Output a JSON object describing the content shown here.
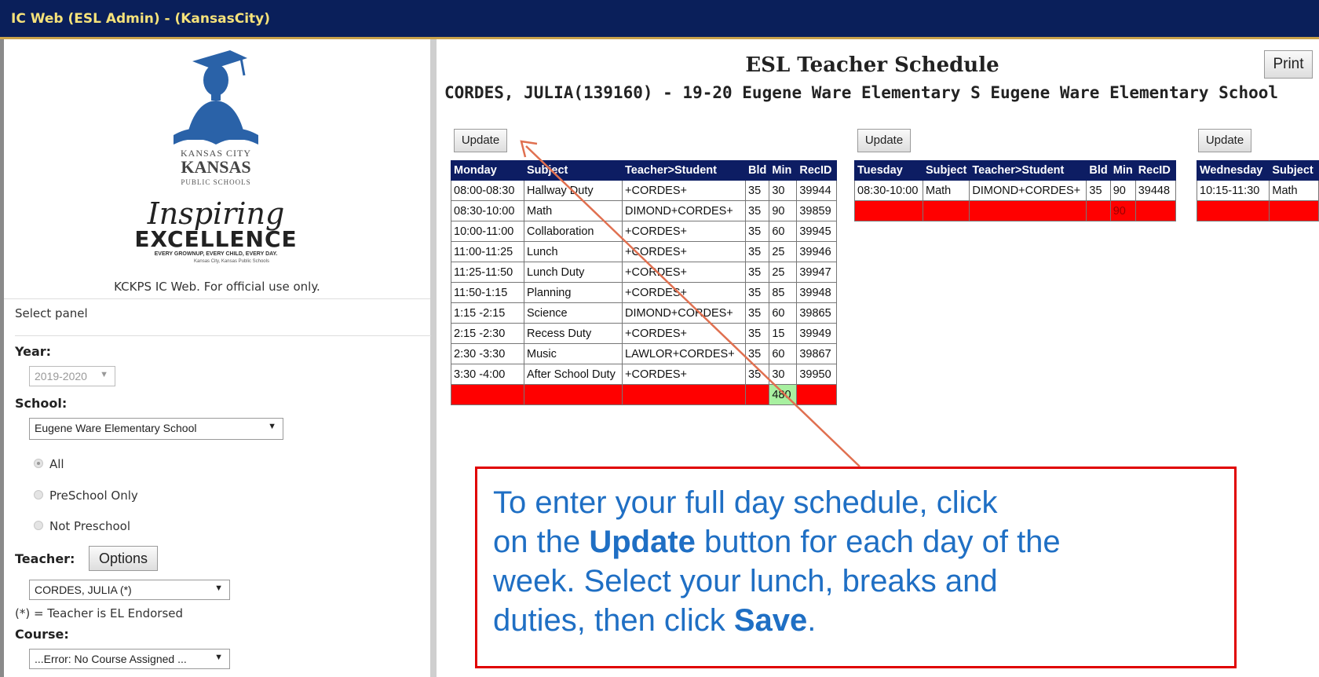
{
  "window": {
    "title": "IC Web (ESL Admin) -  (KansasCity)"
  },
  "logo": {
    "district_line1": "KANSAS CITY",
    "district_line2": "KANSAS",
    "district_line3": "PUBLIC SCHOOLS",
    "inspiring": "Inspiring",
    "excellence": "EXCELLENCE",
    "tagline": "EVERY GROWNUP, EVERY CHILD, EVERY DAY.",
    "tagline_small": "Kansas City, Kansas Public Schools"
  },
  "sidebar": {
    "official_text": "KCKPS IC Web. For official use only.",
    "select_panel": "Select panel",
    "year_label": "Year:",
    "year_value": "2019-2020",
    "school_label": "School:",
    "school_value": "Eugene Ware Elementary School",
    "radios": [
      {
        "label": "All",
        "checked": true
      },
      {
        "label": "PreSchool Only",
        "checked": false
      },
      {
        "label": "Not Preschool",
        "checked": false
      }
    ],
    "teacher_label": "Teacher:",
    "options_button": "Options",
    "teacher_value": "CORDES, JULIA (*)",
    "endorsed_note": "(*) = Teacher is EL Endorsed",
    "course_label": "Course:",
    "course_value": "...Error: No Course Assigned ..."
  },
  "main": {
    "title": "ESL Teacher Schedule",
    "print_button": "Print",
    "subtitle": "CORDES, JULIA(139160) - 19-20 Eugene Ware Elementary S   Eugene Ware Elementary School",
    "update_button": "Update"
  },
  "monday": {
    "headers": [
      "Monday",
      "Subject",
      "Teacher>Student",
      "Bld",
      "Min",
      "RecID"
    ],
    "rows": [
      [
        "08:00-08:30",
        "Hallway Duty",
        "+CORDES+",
        "35",
        "30",
        "39944"
      ],
      [
        "08:30-10:00",
        "Math",
        "DIMOND+CORDES+",
        "35",
        "90",
        "39859"
      ],
      [
        "10:00-11:00",
        "Collaboration",
        "+CORDES+",
        "35",
        "60",
        "39945"
      ],
      [
        "11:00-11:25",
        "Lunch",
        "+CORDES+",
        "35",
        "25",
        "39946"
      ],
      [
        "11:25-11:50",
        "Lunch Duty",
        "+CORDES+",
        "35",
        "25",
        "39947"
      ],
      [
        "11:50-1:15",
        "Planning",
        "+CORDES+",
        "35",
        "85",
        "39948"
      ],
      [
        "1:15 -2:15",
        "Science",
        "DIMOND+CORDES+",
        "35",
        "60",
        "39865"
      ],
      [
        "2:15 -2:30",
        "Recess Duty",
        "+CORDES+",
        "35",
        "15",
        "39949"
      ],
      [
        "2:30 -3:30",
        "Music",
        "LAWLOR+CORDES+",
        "35",
        "60",
        "39867"
      ],
      [
        "3:30 -4:00",
        "After School Duty",
        "+CORDES+",
        "35",
        "30",
        "39950"
      ]
    ],
    "total_min": "480"
  },
  "tuesday": {
    "headers": [
      "Tuesday",
      "Subject",
      "Teacher>Student",
      "Bld",
      "Min",
      "RecID"
    ],
    "rows": [
      [
        "08:30-10:00",
        "Math",
        "DIMOND+CORDES+",
        "35",
        "90",
        "39448"
      ]
    ],
    "total_min": "90"
  },
  "wednesday": {
    "headers": [
      "Wednesday",
      "Subject"
    ],
    "rows": [
      [
        "10:15-11:30",
        "Math"
      ]
    ]
  },
  "callout": {
    "line1": "To enter your full day schedule, click",
    "line2_a": "on the ",
    "line2_b": "Update",
    "line2_c": " button for each day of the",
    "line3": "week. Select your lunch, breaks and",
    "line4_a": "duties, then click ",
    "line4_b": "Save",
    "line4_c": "."
  },
  "colors": {
    "titlebar": "#0a1f5a",
    "title_text": "#f6e27a",
    "table_header": "#0d1d63",
    "total_row": "#ff0000",
    "total_ok": "#a8f0a0",
    "callout_border": "#e00000",
    "callout_text": "#1f6fc4",
    "arrow": "#e07050"
  }
}
